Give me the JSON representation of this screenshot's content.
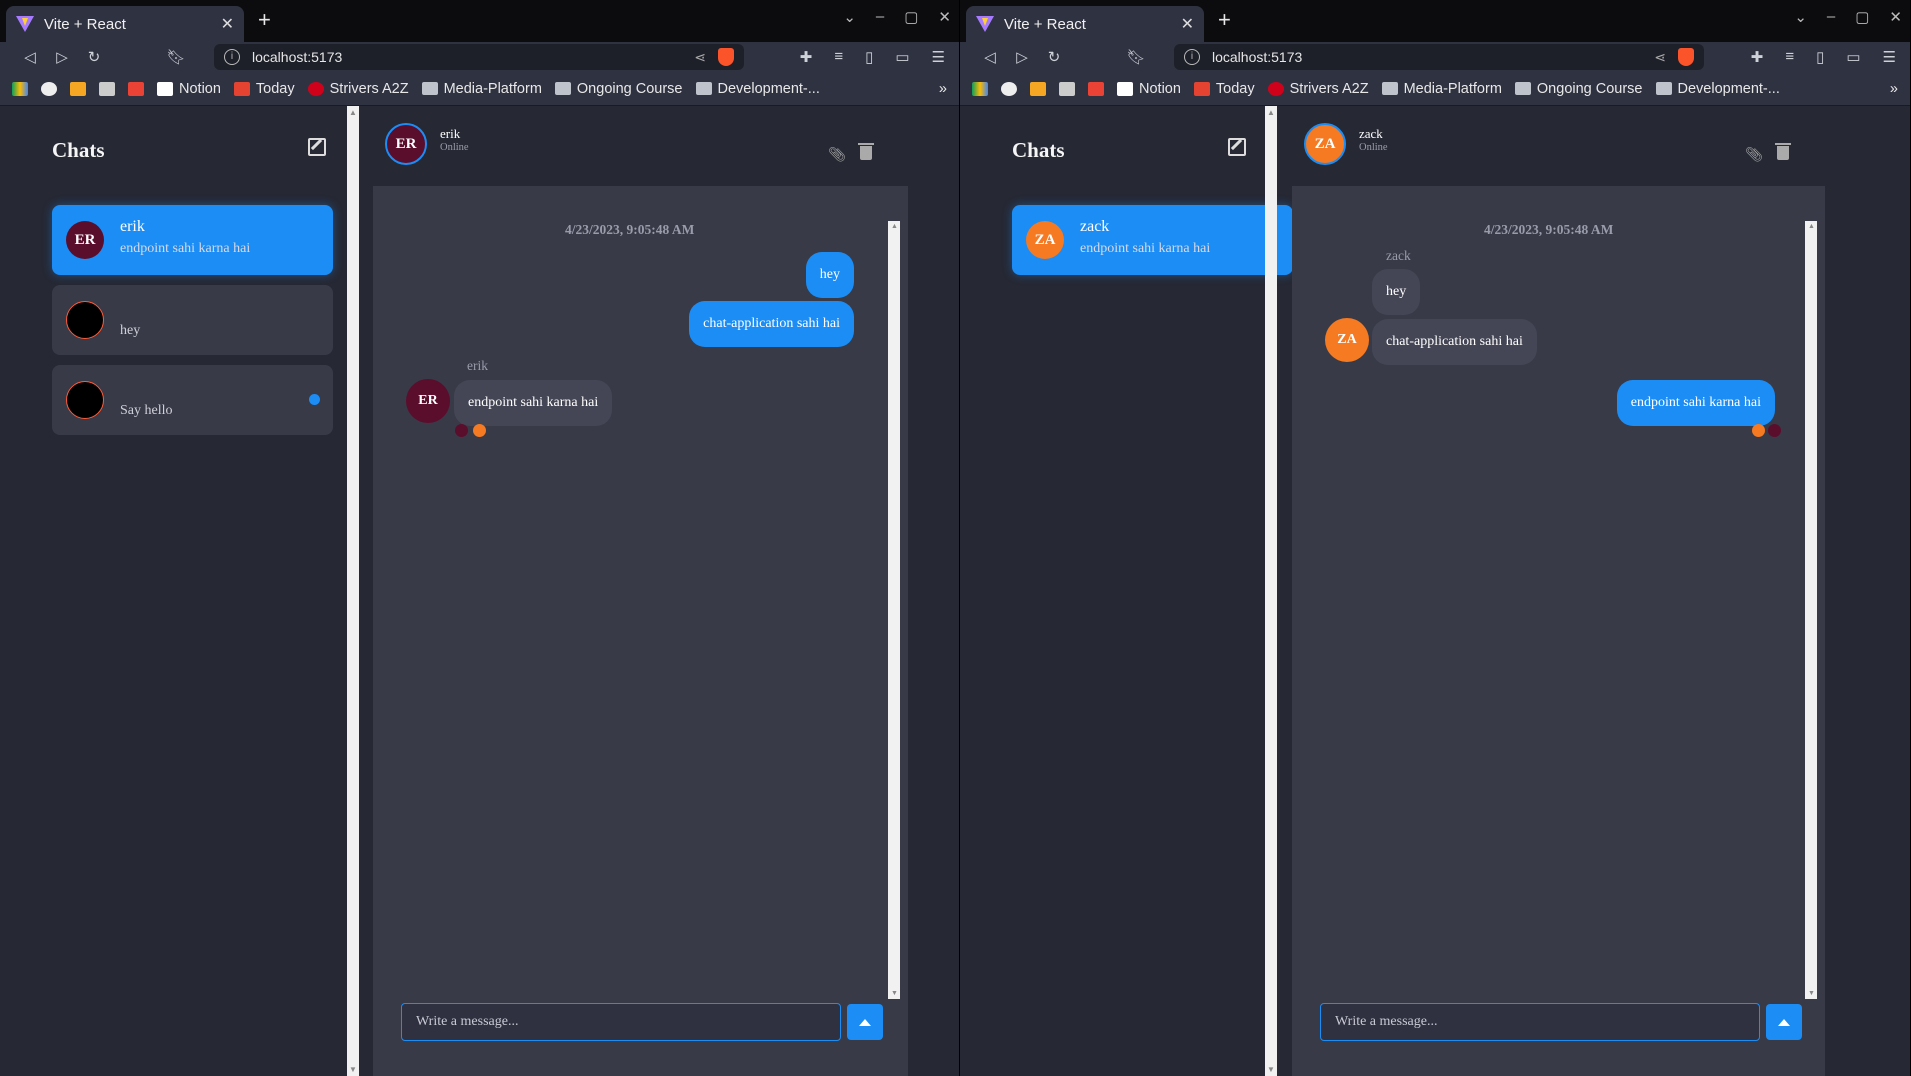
{
  "browser": {
    "tab_title": "Vite + React",
    "url": "localhost:5173",
    "bookmarks": [
      "Notion",
      "Today",
      "Strivers A2Z",
      "Media-Platform",
      "Ongoing Course",
      "Development-..."
    ]
  },
  "left": {
    "sidebar": {
      "title": "Chats",
      "conversations": [
        {
          "initials": "ER",
          "name": "erik",
          "last": "endpoint sahi karna hai"
        },
        {
          "initials": "",
          "name": "",
          "last": "hey"
        },
        {
          "initials": "",
          "name": "",
          "last": "Say hello"
        }
      ]
    },
    "chat": {
      "initials": "ER",
      "name": "erik",
      "status": "Online",
      "timestamp": "4/23/2023, 9:05:48 AM",
      "messages": [
        {
          "text": "hey"
        },
        {
          "text": "chat-application sahi hai"
        },
        {
          "sender": "erik",
          "initials": "ER",
          "text": "endpoint sahi karna hai"
        }
      ],
      "placeholder": "Write a message..."
    }
  },
  "right": {
    "sidebar": {
      "title": "Chats",
      "conversations": [
        {
          "initials": "ZA",
          "name": "zack",
          "last": "endpoint sahi karna hai"
        }
      ]
    },
    "chat": {
      "initials": "ZA",
      "name": "zack",
      "status": "Online",
      "timestamp": "4/23/2023, 9:05:48 AM",
      "messages": [
        {
          "sender": "zack",
          "text": "hey"
        },
        {
          "initials": "ZA",
          "text": "chat-application sahi hai"
        },
        {
          "text": "endpoint sahi karna hai"
        }
      ],
      "placeholder": "Write a message..."
    }
  },
  "colors": {
    "accent": "#1b8df5",
    "erik_avatar": "#5b0d2c",
    "zack_avatar": "#f57a22",
    "panel": "#383a48",
    "sidebar": "#262833"
  }
}
